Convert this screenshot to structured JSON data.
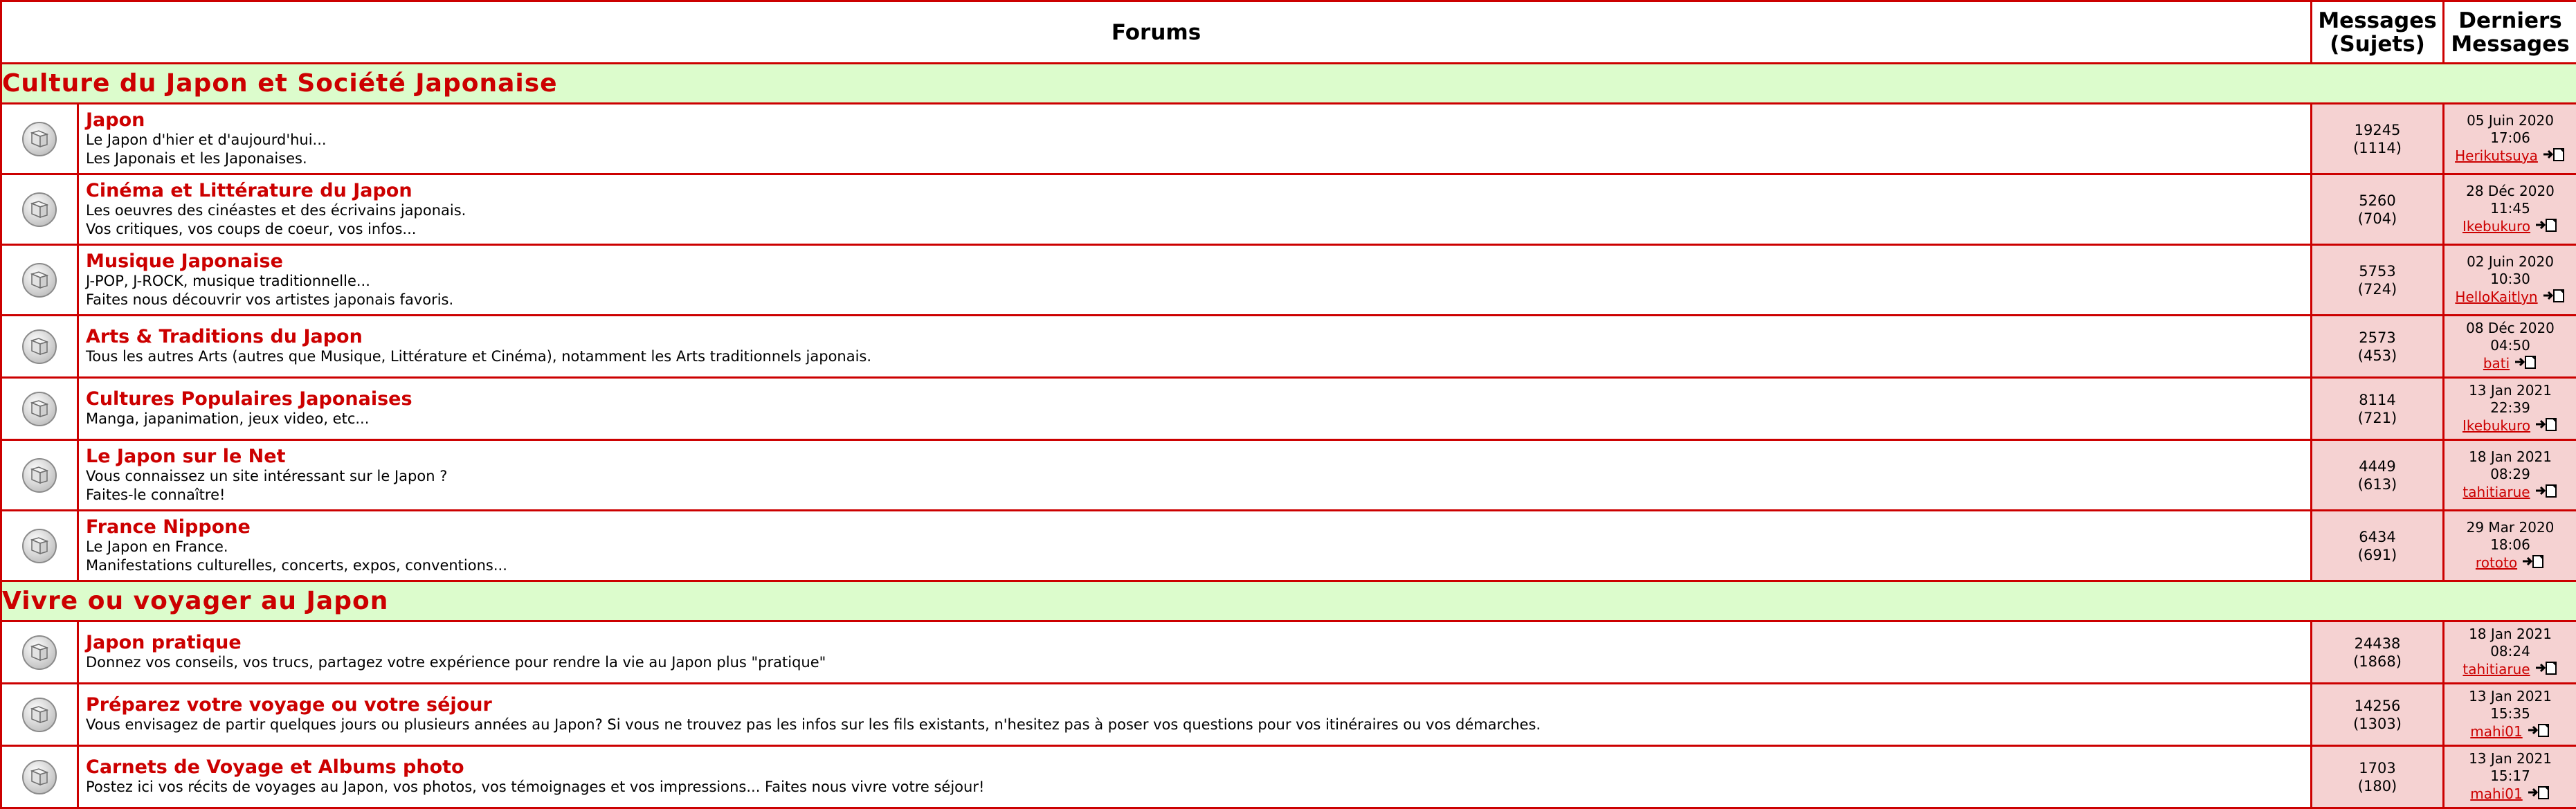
{
  "header": {
    "forums": "Forums",
    "messages": "Messages",
    "subjects": "(Sujets)",
    "last1": "Derniers",
    "last2": "Messages"
  },
  "colors": {
    "accent": "#cc0000",
    "category_bg": "#dcfccc",
    "stats_bg": "#f5d2d2"
  },
  "icons": {
    "forum": "forum-read-icon",
    "goto": "goto-last-post-icon"
  },
  "categories": [
    {
      "title": "Culture du Japon et Société Japonaise",
      "forums": [
        {
          "name": "Japon",
          "desc1": "Le Japon d'hier et d'aujourd'hui...",
          "desc2": "Les Japonais et les Japonaises.",
          "posts": "19245",
          "topics": "(1114)",
          "date": "05 Juin 2020",
          "time": "17:06",
          "user": "Herikutsuya"
        },
        {
          "name": "Cinéma et Littérature du Japon",
          "desc1": "Les oeuvres des cinéastes et des écrivains japonais.",
          "desc2": "Vos critiques, vos coups de coeur, vos infos...",
          "posts": "5260",
          "topics": "(704)",
          "date": "28 Déc 2020",
          "time": "11:45",
          "user": "Ikebukuro"
        },
        {
          "name": "Musique Japonaise",
          "desc1": "J-POP, J-ROCK, musique traditionnelle...",
          "desc2": "Faites nous découvrir vos artistes japonais favoris.",
          "posts": "5753",
          "topics": "(724)",
          "date": "02 Juin 2020",
          "time": "10:30",
          "user": "HelloKaitlyn"
        },
        {
          "name": "Arts & Traditions du Japon",
          "desc1": "Tous les autres Arts (autres que Musique, Littérature et Cinéma), notamment les Arts traditionnels japonais.",
          "desc2": "",
          "posts": "2573",
          "topics": "(453)",
          "date": "08 Déc 2020",
          "time": "04:50",
          "user": "bati"
        },
        {
          "name": "Cultures Populaires Japonaises",
          "desc1": "Manga, japanimation, jeux video, etc...",
          "desc2": "",
          "posts": "8114",
          "topics": "(721)",
          "date": "13 Jan 2021",
          "time": "22:39",
          "user": "Ikebukuro"
        },
        {
          "name": "Le Japon sur le Net",
          "desc1": "Vous connaissez un site intéressant sur le Japon ?",
          "desc2": "Faites-le connaître!",
          "posts": "4449",
          "topics": "(613)",
          "date": "18 Jan 2021",
          "time": "08:29",
          "user": "tahitiarue"
        },
        {
          "name": "France Nippone",
          "desc1": "Le Japon en France.",
          "desc2": "Manifestations culturelles, concerts, expos, conventions...",
          "posts": "6434",
          "topics": "(691)",
          "date": "29 Mar 2020",
          "time": "18:06",
          "user": "rototo"
        }
      ]
    },
    {
      "title": "Vivre ou voyager au Japon",
      "forums": [
        {
          "name": "Japon pratique",
          "desc1": "Donnez vos conseils, vos trucs, partagez votre expérience pour rendre la vie au Japon plus \"pratique\"",
          "desc2": "",
          "posts": "24438",
          "topics": "(1868)",
          "date": "18 Jan 2021",
          "time": "08:24",
          "user": "tahitiarue"
        },
        {
          "name": "Préparez votre voyage ou votre séjour",
          "desc1": "Vous envisagez de partir quelques jours ou plusieurs années au Japon? Si vous ne trouvez pas les infos sur les fils existants, n'hesitez pas à poser vos questions pour vos itinéraires ou vos démarches.",
          "desc2": "",
          "posts": "14256",
          "topics": "(1303)",
          "date": "13 Jan 2021",
          "time": "15:35",
          "user": "mahi01"
        },
        {
          "name": "Carnets de Voyage et Albums photo",
          "desc1": "Postez ici vos récits de voyages au Japon, vos photos, vos témoignages et vos impressions... Faites nous vivre votre séjour!",
          "desc2": "",
          "posts": "1703",
          "topics": "(180)",
          "date": "13 Jan 2021",
          "time": "15:17",
          "user": "mahi01"
        }
      ]
    }
  ]
}
